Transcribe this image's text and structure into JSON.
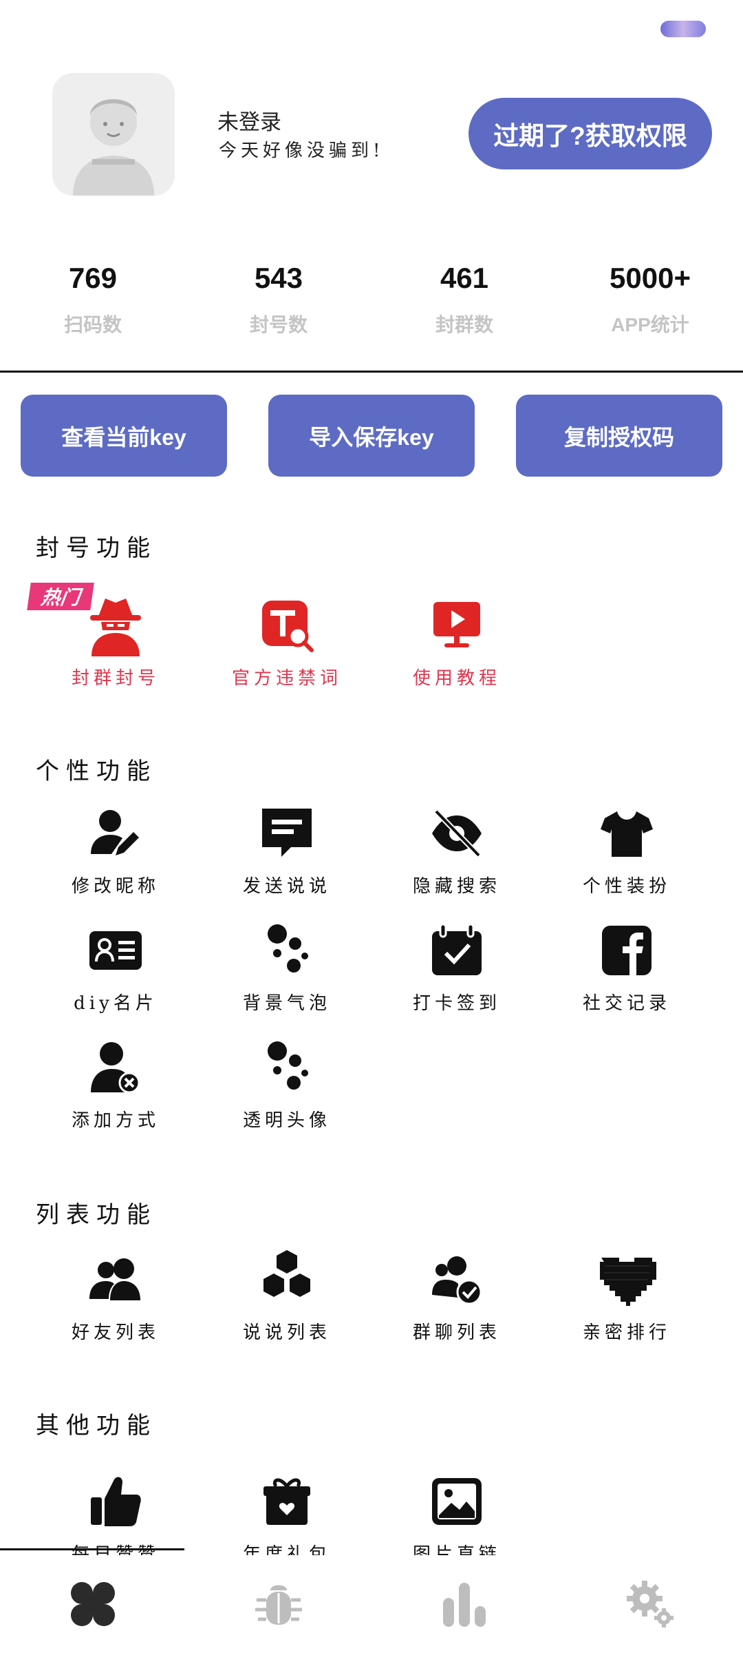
{
  "profile": {
    "name": "未登录",
    "subtitle": "今天好像没骗到!",
    "permission_button": "过期了?获取权限"
  },
  "stats": [
    {
      "value": "769",
      "label": "扫码数"
    },
    {
      "value": "543",
      "label": "封号数"
    },
    {
      "value": "461",
      "label": "封群数"
    },
    {
      "value": "5000+",
      "label": "APP统计"
    }
  ],
  "key_buttons": [
    "查看当前key",
    "导入保存key",
    "复制授权码"
  ],
  "sections": {
    "ban": {
      "title": "封号功能",
      "badge": "热门",
      "items": [
        "封群封号",
        "官方违禁词",
        "使用教程"
      ]
    },
    "personal": {
      "title": "个性功能",
      "items": [
        "修改昵称",
        "发送说说",
        "隐藏搜索",
        "个性装扮",
        "diy名片",
        "背景气泡",
        "打卡签到",
        "社交记录",
        "添加方式",
        "透明头像"
      ]
    },
    "list": {
      "title": "列表功能",
      "items": [
        "好友列表",
        "说说列表",
        "群聊列表",
        "亲密排行"
      ]
    },
    "other": {
      "title": "其他功能",
      "items": [
        "每日赞赞",
        "年度礼包",
        "图片直链"
      ]
    }
  },
  "nav": [
    "clover-icon",
    "bug-icon",
    "bar-chart-icon",
    "settings-icon"
  ],
  "colors": {
    "accent": "#5d6bc4",
    "red": "#e0354e",
    "gray_text": "#c4c4c4"
  }
}
